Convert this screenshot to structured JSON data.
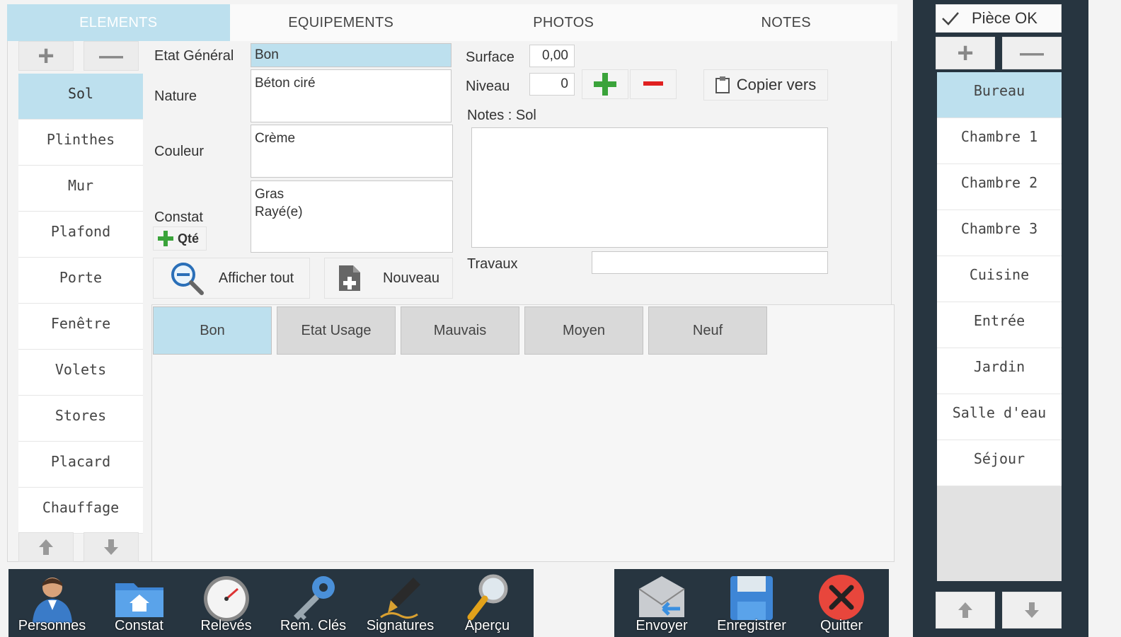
{
  "tabs": [
    {
      "label": "ELEMENTS",
      "active": true
    },
    {
      "label": "EQUIPEMENTS",
      "active": false
    },
    {
      "label": "PHOTOS",
      "active": false
    },
    {
      "label": "NOTES",
      "active": false
    }
  ],
  "elements": {
    "add_symbol": "+",
    "remove_symbol": "—",
    "items": [
      "Sol",
      "Plinthes",
      "Mur",
      "Plafond",
      "Porte",
      "Fenêtre",
      "Volets",
      "Stores",
      "Placard",
      "Chauffage"
    ],
    "selected": "Sol"
  },
  "form": {
    "etat_label": "Etat Général",
    "etat_value": "Bon",
    "nature_label": "Nature",
    "nature_value": "Béton ciré",
    "couleur_label": "Couleur",
    "couleur_value": "Crème",
    "constat_label": "Constat",
    "constat_line1": "Gras",
    "constat_line2": "Rayé(e)",
    "qte_label": "Qté",
    "surface_label": "Surface",
    "surface_value": "0,00",
    "niveau_label": "Niveau",
    "niveau_value": "0",
    "copier_label": "Copier vers",
    "notes_label": "Notes : Sol",
    "notes_value": "",
    "travaux_label": "Travaux",
    "travaux_value": "",
    "afficher_label": "Afficher tout",
    "nouveau_label": "Nouveau"
  },
  "etat_options": [
    "Bon",
    "Etat Usage",
    "Mauvais",
    "Moyen",
    "Neuf"
  ],
  "rooms": {
    "piece_ok_label": "Pièce OK",
    "items": [
      "Bureau",
      "Chambre 1",
      "Chambre 2",
      "Chambre 3",
      "Cuisine",
      "Entrée",
      "Jardin",
      "Salle d'eau",
      "Séjour"
    ],
    "selected": "Bureau"
  },
  "toolbar_left": [
    {
      "label": "Personnes",
      "icon": "person-icon"
    },
    {
      "label": "Constat",
      "icon": "folder-home-icon"
    },
    {
      "label": "Relevés",
      "icon": "gauge-icon"
    },
    {
      "label": "Rem. Clés",
      "icon": "key-icon"
    },
    {
      "label": "Signatures",
      "icon": "pen-icon"
    },
    {
      "label": "Aperçu",
      "icon": "magnifier-icon"
    }
  ],
  "toolbar_right": [
    {
      "label": "Envoyer",
      "icon": "envelope-icon"
    },
    {
      "label": "Enregistrer",
      "icon": "floppy-icon"
    },
    {
      "label": "Quitter",
      "icon": "close-icon"
    }
  ],
  "colors": {
    "accent": "#bde0ee",
    "dark": "#273540",
    "add_green": "#3aa33a",
    "remove_red": "#e02020",
    "quit_red": "#e8463c"
  }
}
